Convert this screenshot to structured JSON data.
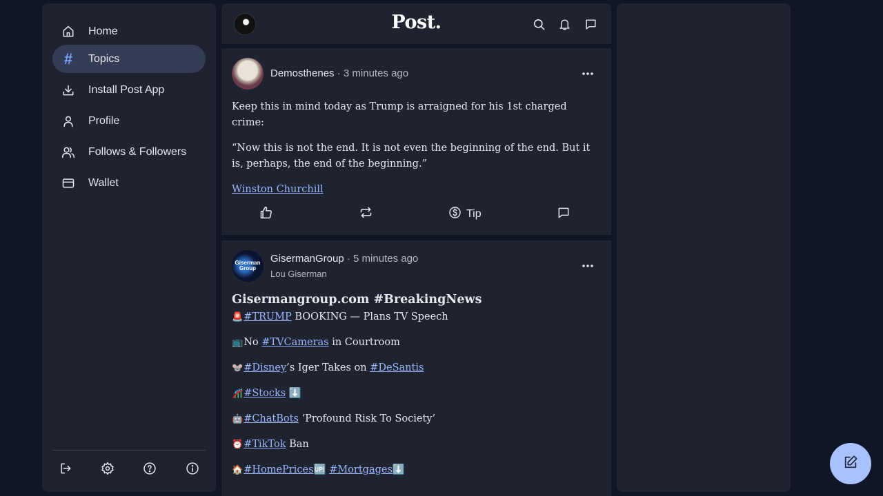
{
  "sidebar": {
    "items": [
      {
        "label": "Home",
        "icon": "home-icon"
      },
      {
        "label": "Topics",
        "icon": "hash-icon",
        "active": true
      },
      {
        "label": "Install Post App",
        "icon": "download-icon"
      },
      {
        "label": "Profile",
        "icon": "user-icon"
      },
      {
        "label": "Follows & Followers",
        "icon": "users-icon"
      },
      {
        "label": "Wallet",
        "icon": "wallet-icon"
      }
    ],
    "footer_icons": [
      "logout-icon",
      "gear-icon",
      "help-icon",
      "info-icon"
    ]
  },
  "header": {
    "logo": "Post.",
    "icons": [
      "search-icon",
      "bell-icon",
      "chat-icon"
    ]
  },
  "posts": [
    {
      "author": "Demosthenes",
      "time": " · 3 minutes ago",
      "paragraphs": [
        "Keep this in mind today as Trump is arraigned for his 1st charged crime:",
        "“Now this is not the end. It is not even the beginning of the end. But it is, perhaps, the end of the beginning.”"
      ],
      "link": "Winston Churchill",
      "actions": {
        "tip_label": "Tip"
      }
    },
    {
      "author": "GisermanGroup",
      "time": " · 5 minutes ago",
      "sub_author": "Lou Giserman",
      "avatar_text": "Giserman Group",
      "headline": "Gisermangroup.com #BreakingNews",
      "lines": [
        {
          "emoji": "🚨",
          "tag": "#TRUMP",
          "text": " BOOKING — Plans TV Speech"
        },
        {
          "emoji": "📺",
          "pre": "No ",
          "tag": "#TVCameras",
          "text": " in Courtroom"
        },
        {
          "emoji": "🐭",
          "tag": "#Disney",
          "text": "’s Iger Takes on ",
          "tag2": "#DeSantis"
        },
        {
          "emoji": "🎢",
          "tag": "#Stocks",
          "text": " ⬇️"
        },
        {
          "emoji": "🤖",
          "tag": "#ChatBots",
          "text": " ‘Profound Risk To Society’"
        },
        {
          "emoji": "⏰",
          "tag": "#TikTok",
          "text": " Ban"
        },
        {
          "emoji": "🏠",
          "tag": "#HomePrices",
          "text": "🆙 ",
          "tag2": "#Mortgages",
          "text2": "⬇️"
        }
      ]
    }
  ],
  "colors": {
    "background": "#0f1726",
    "panel": "#1f2330",
    "accent": "#7aa2ff",
    "fab": "#a9c2ff"
  }
}
